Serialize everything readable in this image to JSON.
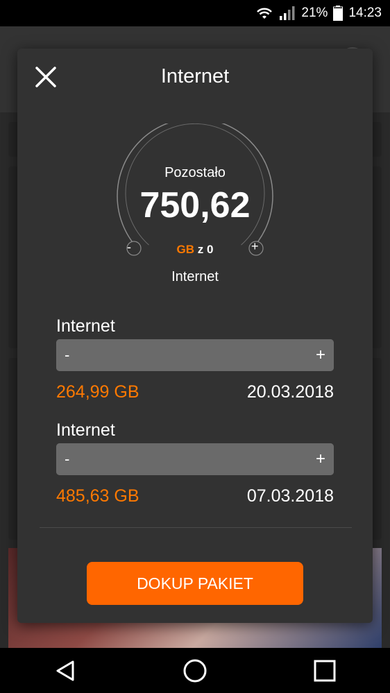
{
  "status_bar": {
    "battery_percent": "21%",
    "time": "14:23",
    "icons": [
      "wifi-icon",
      "signal-icon",
      "battery-icon"
    ]
  },
  "dialog": {
    "title": "Internet",
    "close_icon": "close-icon",
    "gauge": {
      "label": "Pozostało",
      "value": "750,62",
      "unit": "GB",
      "of_text": " z 0",
      "minus": "-",
      "plus": "+",
      "caption": "Internet",
      "fill_fraction": 0
    },
    "packages": [
      {
        "name": "Internet",
        "amount": "264,99 GB",
        "date": "20.03.2018",
        "minus": "-",
        "plus": "+"
      },
      {
        "name": "Internet",
        "amount": "485,63 GB",
        "date": "07.03.2018",
        "minus": "-",
        "plus": "+"
      }
    ],
    "cta_label": "DOKUP PAKIET"
  },
  "colors": {
    "accent": "#ff7900",
    "button": "#ff6600",
    "dialog_bg": "#323232",
    "bar_bg": "#6a6a6a"
  },
  "nav_bar": {
    "icons": [
      "back-icon",
      "home-icon",
      "recents-icon"
    ]
  }
}
